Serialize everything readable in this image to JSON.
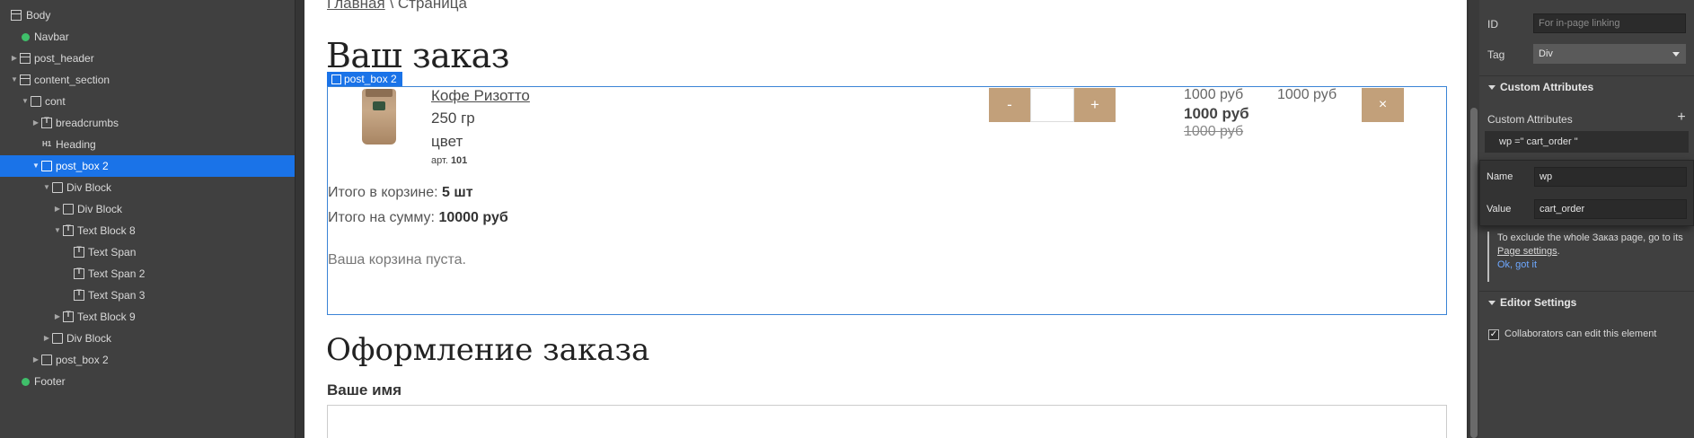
{
  "navigator": {
    "items": [
      {
        "label": "Body",
        "icon": "body-icon"
      },
      {
        "label": "Navbar",
        "icon": "symbol-icon"
      },
      {
        "label": "post_header",
        "icon": "body-icon"
      },
      {
        "label": "content_section",
        "icon": "body-icon"
      },
      {
        "label": "cont",
        "icon": "div-icon"
      },
      {
        "label": "breadcrumbs",
        "icon": "text-block-icon"
      },
      {
        "label": "Heading",
        "icon": "heading-icon"
      },
      {
        "label": "post_box 2",
        "icon": "div-icon"
      },
      {
        "label": "Div Block",
        "icon": "div-icon"
      },
      {
        "label": "Div Block",
        "icon": "div-icon"
      },
      {
        "label": "Text Block 8",
        "icon": "text-block-icon"
      },
      {
        "label": "Text Span",
        "icon": "text-block-icon"
      },
      {
        "label": "Text Span 2",
        "icon": "text-block-icon"
      },
      {
        "label": "Text Span 3",
        "icon": "text-block-icon"
      },
      {
        "label": "Text Block 9",
        "icon": "text-block-icon"
      },
      {
        "label": "Div Block",
        "icon": "div-icon"
      },
      {
        "label": "post_box 2",
        "icon": "div-icon"
      },
      {
        "label": "Footer",
        "icon": "symbol-icon"
      }
    ],
    "heading_icon_text": "H1"
  },
  "canvas": {
    "breadcrumb_link": "Главная",
    "breadcrumb_rest": " \\ Страница",
    "heading": "Ваш заказ",
    "selected_tag": "post_box 2",
    "product": {
      "name": "Кофе Ризотто",
      "weight": "250 гр",
      "color": "цвет",
      "article_label": "арт.",
      "article_value": "101"
    },
    "qty_minus": "-",
    "qty_plus": "+",
    "price_1": "1000 руб",
    "price_2": "1000 руб",
    "price_old": "1000 руб",
    "price_total": "1000 руб",
    "remove_label": "×",
    "cart_count_label": "Итого в корзине: ",
    "cart_count_value": "5 шт",
    "cart_sum_label": "Итого на сумму: ",
    "cart_sum_value": "10000 руб",
    "empty_text": "Ваша корзина пуста.",
    "checkout_heading": "Оформление заказа",
    "name_label": "Ваше имя"
  },
  "panel": {
    "id_label": "ID",
    "id_placeholder": "For in-page linking",
    "tag_label": "Tag",
    "tag_value": "Div",
    "custom_attrs_section": "Custom Attributes",
    "custom_attrs_label": "Custom Attributes",
    "add_label": "+",
    "attr_summary": "wp =\" cart_order \"",
    "name_label": "Name",
    "name_value": "wp",
    "value_label": "Value",
    "value_value": "cart_order",
    "note_text": "To exclude the whole Заказ page, go to its ",
    "note_link": "Page settings",
    "note_end": ".",
    "note_ok": "Ok, got it",
    "editor_section": "Editor Settings",
    "collab_label": "Collaborators can edit this element",
    "collab_checked": true,
    "check_mark": "✓"
  }
}
